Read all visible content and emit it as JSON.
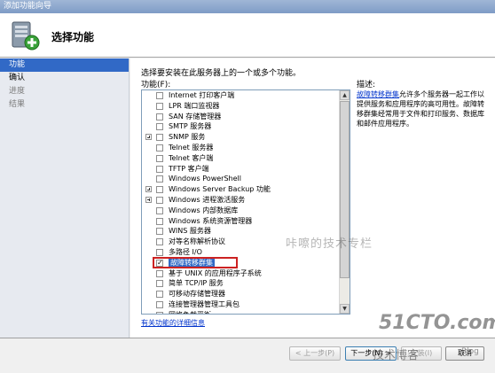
{
  "window": {
    "title": "添加功能向导"
  },
  "header": {
    "title": "选择功能"
  },
  "nav": {
    "items": [
      {
        "label": "功能",
        "state": "active"
      },
      {
        "label": "确认",
        "state": "normal"
      },
      {
        "label": "进度",
        "state": "dim"
      },
      {
        "label": "结果",
        "state": "dim"
      }
    ]
  },
  "main": {
    "instruction": "选择要安装在此服务器上的一个或多个功能。",
    "features_label": "功能(F):",
    "features": [
      {
        "label": "Internet 打印客户端",
        "expandable": false,
        "checked": false,
        "selected": false
      },
      {
        "label": "LPR 端口监视器",
        "expandable": false,
        "checked": false,
        "selected": false
      },
      {
        "label": "SAN 存储管理器",
        "expandable": false,
        "checked": false,
        "selected": false
      },
      {
        "label": "SMTP 服务器",
        "expandable": false,
        "checked": false,
        "selected": false
      },
      {
        "label": "SNMP 服务",
        "expandable": true,
        "checked": false,
        "selected": false
      },
      {
        "label": "Telnet 服务器",
        "expandable": false,
        "checked": false,
        "selected": false
      },
      {
        "label": "Telnet 客户端",
        "expandable": false,
        "checked": false,
        "selected": false
      },
      {
        "label": "TFTP 客户端",
        "expandable": false,
        "checked": false,
        "selected": false
      },
      {
        "label": "Windows PowerShell",
        "expandable": false,
        "checked": false,
        "selected": false
      },
      {
        "label": "Windows Server Backup 功能",
        "expandable": true,
        "checked": false,
        "selected": false
      },
      {
        "label": "Windows 进程激活服务",
        "expandable": true,
        "checked": false,
        "selected": false
      },
      {
        "label": "Windows 内部数据库",
        "expandable": false,
        "checked": false,
        "selected": false
      },
      {
        "label": "Windows 系统资源管理器",
        "expandable": false,
        "checked": false,
        "selected": false
      },
      {
        "label": "WINS 服务器",
        "expandable": false,
        "checked": false,
        "selected": false
      },
      {
        "label": "对等名称解析协议",
        "expandable": false,
        "checked": false,
        "selected": false
      },
      {
        "label": "多路径 I/O",
        "expandable": false,
        "checked": false,
        "selected": false
      },
      {
        "label": "故障转移群集",
        "expandable": false,
        "checked": true,
        "selected": true
      },
      {
        "label": "基于 UNIX 的应用程序子系统",
        "expandable": false,
        "checked": false,
        "selected": false
      },
      {
        "label": "简单 TCP/IP 服务",
        "expandable": false,
        "checked": false,
        "selected": false
      },
      {
        "label": "可移动存储管理器",
        "expandable": false,
        "checked": false,
        "selected": false
      },
      {
        "label": "连接管理器管理工具包",
        "expandable": false,
        "checked": false,
        "selected": false
      },
      {
        "label": "网络负载平衡",
        "expandable": false,
        "checked": false,
        "selected": false
      }
    ],
    "description_label": "描述:",
    "description_link": "故障转移群集",
    "description_text": "允许多个服务器一起工作以提供服务和应用程序的高可用性。故障转移群集经常用于文件和打印服务、数据库和邮件应用程序。",
    "more_info_link": "有关功能的详细信息"
  },
  "buttons": {
    "prev": "< 上一步(P)",
    "next": "下一步(N) >",
    "install": "安装(I)",
    "cancel": "取消"
  },
  "watermark": "咔嚓的技术专栏",
  "site_logo": {
    "main": "51CTO.com",
    "sub": "技术博客",
    "blog": "Blog"
  },
  "colors": {
    "selection": "#3169c6",
    "highlight_box": "#cc2222",
    "link": "#0033cc"
  }
}
